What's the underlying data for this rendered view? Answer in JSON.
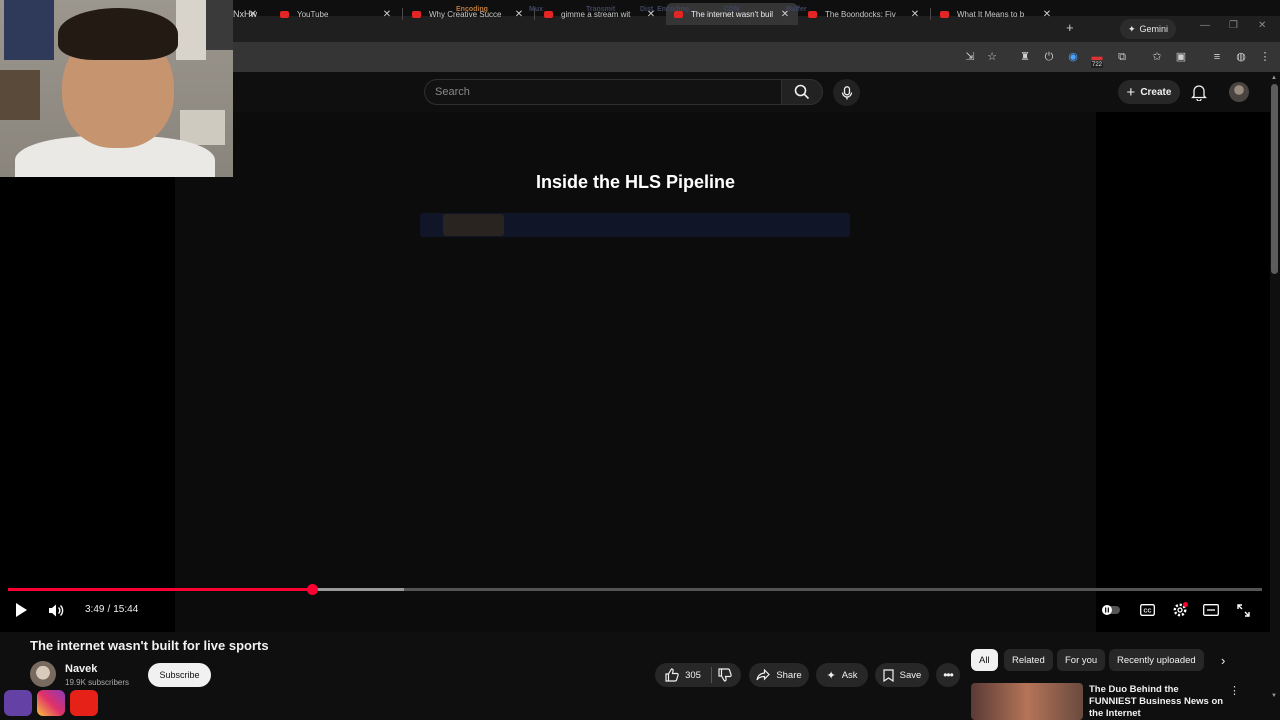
{
  "browser": {
    "tabs": [
      {
        "label": "",
        "active": false
      },
      {
        "label": "YouTube",
        "active": false
      },
      {
        "label": "Why Creative Succe",
        "active": false
      },
      {
        "label": "gimme a stream wit",
        "active": false
      },
      {
        "label": "The internet wasn't buil",
        "active": true
      },
      {
        "label": "The Boondocks: Fiv",
        "active": false
      },
      {
        "label": "What It Means to b",
        "active": false
      }
    ],
    "new_tab": "+",
    "gemini_label": "Gemini",
    "url": "NxHw",
    "extension_badge": "722"
  },
  "header": {
    "search_placeholder": "Search",
    "create_label": "Create"
  },
  "video": {
    "overlay_title": "Inside the HLS Pipeline",
    "pipeline_stages": [
      "Encoding",
      "Mux",
      "Transmit",
      "Dist. Encoding",
      "CDN",
      "Buffer"
    ],
    "active_stage": "Encoding"
  },
  "player": {
    "current_time": "3:49",
    "separator": "/",
    "duration": "15:44",
    "played_fraction": 0.243,
    "buffered_fraction": 0.316
  },
  "details": {
    "title": "The internet wasn't built for live sports",
    "channel": "Navek",
    "subscribers": "19.9K subscribers",
    "subscribe_label": "Subscribe",
    "likes": "305",
    "share_label": "Share",
    "ask_label": "Ask",
    "save_label": "Save"
  },
  "recommendations": {
    "chips": [
      "All",
      "Related",
      "For you",
      "Recently uploaded"
    ],
    "active_chip": "All",
    "first_title": "The Duo Behind the FUNNIEST Business News on the Internet"
  },
  "colors": {
    "accent": "#ff0033",
    "stage_active": "#b9793a"
  }
}
